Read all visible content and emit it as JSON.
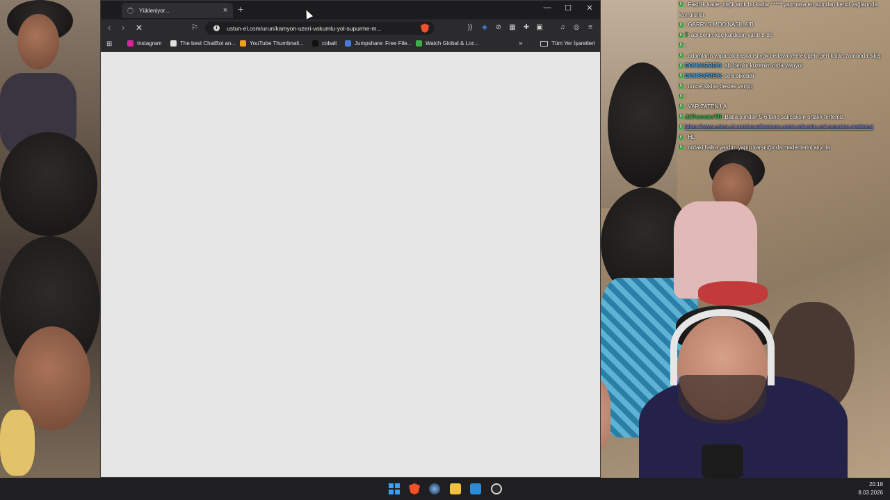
{
  "browser": {
    "tab": {
      "title": "Yükleniyor...",
      "close": "×"
    },
    "new_tab": "+",
    "window_controls": {
      "minimize": "—",
      "maximize": "☐",
      "close": "✕"
    },
    "nav": {
      "back": "‹",
      "forward": "›",
      "stop": "✕"
    },
    "address_bar": {
      "url": "ustun-el.com/urun/kamyon-uzeri-vakumlu-yol-supurme-m..."
    },
    "bookmarks": [
      {
        "label": "Instagram",
        "icon": "instagram-icon",
        "color": "#d6249f"
      },
      {
        "label": "The best ChatBot an...",
        "icon": "chatbot-icon",
        "color": "#e0e0e0"
      },
      {
        "label": "YouTube Thumbnail...",
        "icon": "youtube-thumbnail-icon",
        "color": "#f0a020"
      },
      {
        "label": "cobalt",
        "icon": "cobalt-icon",
        "color": "#111111"
      },
      {
        "label": "Jumpshare: Free File...",
        "icon": "jumpshare-icon",
        "color": "#4a7bd4"
      },
      {
        "label": "Watch Global & Loc...",
        "icon": "twitch-tracker-icon",
        "color": "#3fae49"
      }
    ],
    "more_bookmarks": "»",
    "all_bookmarks": "Tüm Yer İşaretleri"
  },
  "chat": [
    {
      "user": "",
      "user_color": "#ff3b3b",
      "message": ": Fakirlik kader değil amk bu kadar ***** yapmasa en azından kendi yağlarında kavrulurlar",
      "wrap": true
    },
    {
      "user": "",
      "user_color": "#ff3b3b",
      "message": ": GARRYS MOD NASIL AİB"
    },
    {
      "user": "7",
      "user_color": "#2ac94a",
      "message": ": abi senin kaç kardeşin vardı tr de"
    },
    {
      "user": "",
      "user_color": "#2ac94a",
      "message": ":"
    },
    {
      "user": "",
      "user_color": "#2ac94a",
      "message": ": adamların yapacak başka işi yok bedava yemek gelir geri kalan zamanda sikiş",
      "wrap": true
    },
    {
      "user": "DONSUZREIS",
      "user_color": "#3bb0ff",
      "message": ": abi benim kuzenim orda yaşıyor"
    },
    {
      "user": "DONSUZREIS",
      "user_color": "#3bb0ff",
      "message": ": seni sikebilir"
    },
    {
      "user": "",
      "user_color": "#ff3b3b",
      "message": ": unicef sikişe destek veriyo"
    },
    {
      "user": "",
      "user_color": "#ff3b3b",
      "message": ":"
    },
    {
      "user": "",
      "user_color": "#ff3b3b",
      "message": ": VAR ZATEN LA"
    },
    {
      "user": "AliForesterTR",
      "user_color": "#2ac94a",
      "message": ": Baba şundan 5-6 tane salıcaksın ortalık tertemiz"
    },
    {
      "user": "",
      "user_color": "#6b7cff",
      "message": "https://www.ustun-el.com/urun/kamyon-uzeri-vakumlu-yol-supurme-makinesi",
      "link": true
    },
    {
      "user": "",
      "user_color": "#ff3b3b",
      "message": ": HL"
    },
    {
      "user": "",
      "user_color": "#ff3b3b",
      "message": ": ordaki halka yardım yapıp karşılığında madenlerini alıyola"
    }
  ],
  "taskbar": {
    "apps": [
      {
        "name": "start-button",
        "color": "#3aa0ff"
      },
      {
        "name": "brave-browser-icon",
        "color": "#f4502a"
      },
      {
        "name": "steam-icon",
        "color": "#1b2a44"
      },
      {
        "name": "file-explorer-icon",
        "color": "#f3c23d"
      },
      {
        "name": "mail-icon",
        "color": "#2c8bd6"
      },
      {
        "name": "obs-icon",
        "color": "#2a2a2a"
      }
    ],
    "clock": {
      "time": "20:18",
      "date": "8.03.2026"
    }
  }
}
